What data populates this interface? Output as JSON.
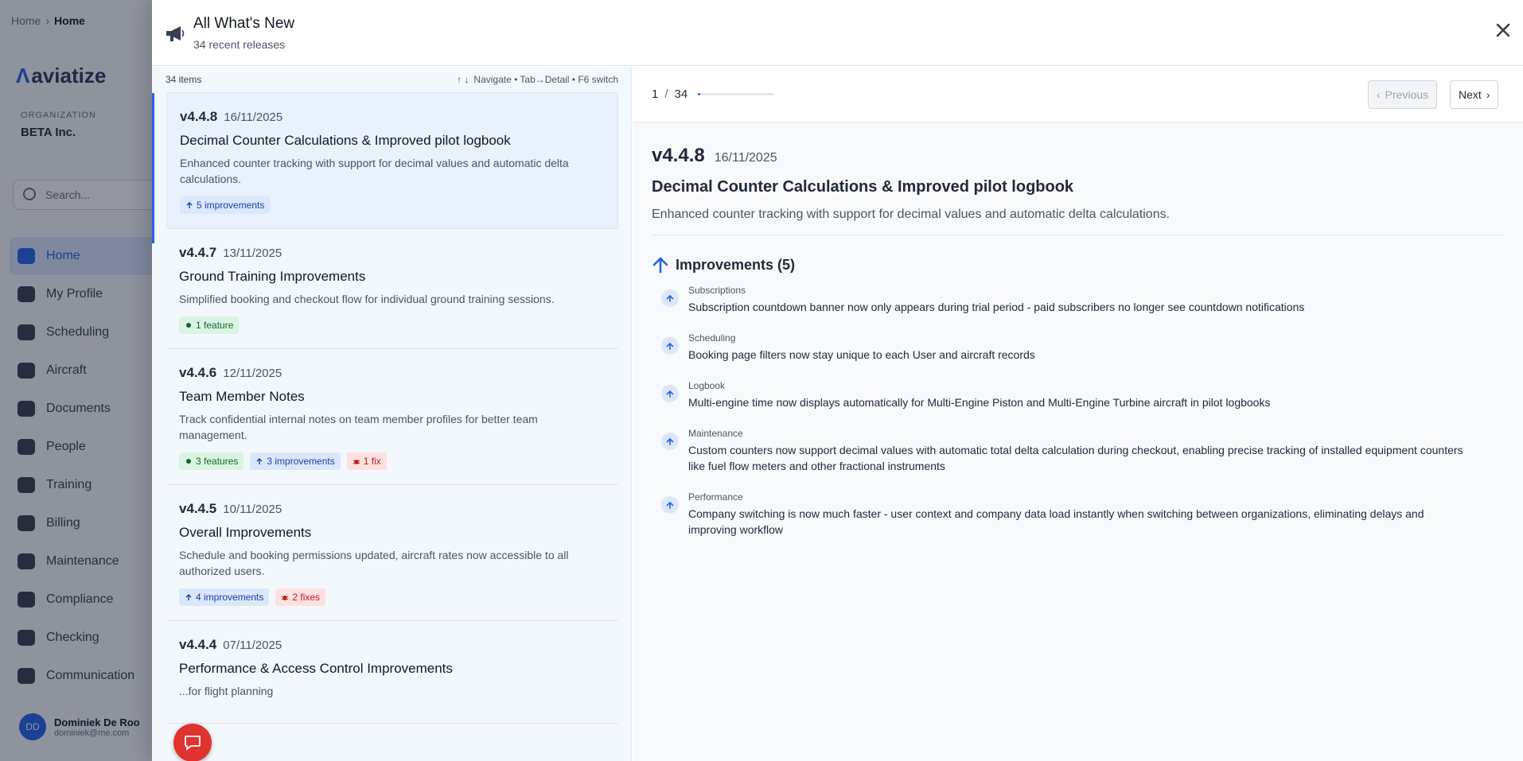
{
  "background": {
    "breadcrumb": {
      "parent": "Home",
      "current": "Home"
    },
    "logo": "aviatize",
    "org_label": "ORGANIZATION",
    "org_name": "BETA Inc.",
    "search_placeholder": "Search...",
    "nav": [
      "Home",
      "My Profile",
      "Scheduling",
      "Aircraft",
      "Documents",
      "People",
      "Training",
      "Billing",
      "Maintenance",
      "Compliance",
      "Checking",
      "Communication"
    ],
    "user": {
      "initials": "DD",
      "name": "Dominiek De Roo",
      "email": "dominiek@me.com"
    }
  },
  "panel": {
    "title": "All What's New",
    "subtitle": "34 recent releases",
    "close_icon": "close-icon"
  },
  "list": {
    "count_label": "34 items",
    "hint": "Navigate • Tab→Detail • F6 switch",
    "items": [
      {
        "version": "v4.4.8",
        "date": "16/11/2025",
        "title": "Decimal Counter Calculations & Improved pilot logbook",
        "description": "Enhanced counter tracking with support for decimal values and automatic delta calculations.",
        "badges": [
          {
            "type": "improve",
            "label": "5 improvements"
          }
        ]
      },
      {
        "version": "v4.4.7",
        "date": "13/11/2025",
        "title": "Ground Training Improvements",
        "description": "Simplified booking and checkout flow for individual ground training sessions.",
        "badges": [
          {
            "type": "feature",
            "label": "1 feature"
          }
        ]
      },
      {
        "version": "v4.4.6",
        "date": "12/11/2025",
        "title": "Team Member Notes",
        "description": "Track confidential internal notes on team member profiles for better team management.",
        "badges": [
          {
            "type": "feature",
            "label": "3 features"
          },
          {
            "type": "improve",
            "label": "3 improvements"
          },
          {
            "type": "fix",
            "label": "1 fix"
          }
        ]
      },
      {
        "version": "v4.4.5",
        "date": "10/11/2025",
        "title": "Overall Improvements",
        "description": "Schedule and booking permissions updated, aircraft rates now accessible to all authorized users.",
        "badges": [
          {
            "type": "improve",
            "label": "4 improvements"
          },
          {
            "type": "fix",
            "label": "2 fixes"
          }
        ]
      },
      {
        "version": "v4.4.4",
        "date": "07/11/2025",
        "title": "Performance & Access Control Improvements",
        "description": "...for flight planning",
        "badges": []
      }
    ]
  },
  "detail": {
    "pager": {
      "current": "1",
      "total": "34",
      "progress": 0.03
    },
    "prev_label": "Previous",
    "next_label": "Next",
    "version": "v4.4.8",
    "date": "16/11/2025",
    "title": "Decimal Counter Calculations & Improved pilot logbook",
    "description": "Enhanced counter tracking with support for decimal values and automatic delta calculations.",
    "section_title": "Improvements (5)",
    "entries": [
      {
        "category": "Subscriptions",
        "text": "Subscription countdown banner now only appears during trial period - paid subscribers no longer see countdown notifications"
      },
      {
        "category": "Scheduling",
        "text": "Booking page filters now stay unique to each User and aircraft records"
      },
      {
        "category": "Logbook",
        "text": "Multi-engine time now displays automatically for Multi-Engine Piston and Multi-Engine Turbine aircraft in pilot logbooks"
      },
      {
        "category": "Maintenance",
        "text": "Custom counters now support decimal values with automatic total delta calculation during checkout, enabling precise tracking of installed equipment counters like fuel flow meters and other fractional instruments"
      },
      {
        "category": "Performance",
        "text": "Company switching is now much faster - user context and company data load instantly when switching between organizations, eliminating delays and improving workflow"
      }
    ]
  },
  "colors": {
    "accent": "#2563eb",
    "chat_fab": "#e0322e"
  }
}
